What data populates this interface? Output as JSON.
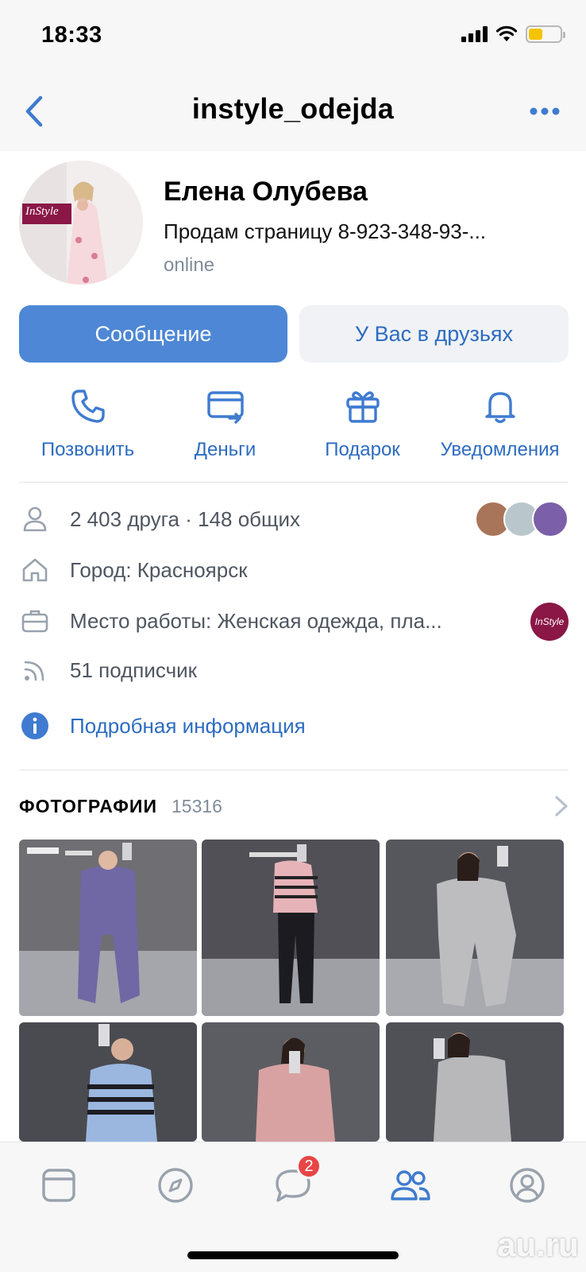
{
  "status_bar": {
    "time": "18:33"
  },
  "nav": {
    "title": "instyle_odejda"
  },
  "profile": {
    "name": "Елена Олубева",
    "status": "Продам страницу 8-923-348-93-...",
    "online": "online",
    "avatar_logo": "InStyle"
  },
  "buttons": {
    "message": "Сообщение",
    "friends": "У Вас в друзьях"
  },
  "actions": [
    {
      "label": "Позвонить",
      "icon": "phone-icon"
    },
    {
      "label": "Деньги",
      "icon": "money-card-icon"
    },
    {
      "label": "Подарок",
      "icon": "gift-icon"
    },
    {
      "label": "Уведомления",
      "icon": "bell-icon"
    }
  ],
  "info": {
    "friends": "2 403 друга · 148 общих",
    "city": "Город: Красноярск",
    "work": "Место работы: Женская одежда, пла...",
    "work_logo": "InStyle",
    "followers": "51 подписчик",
    "more": "Подробная информация"
  },
  "photos": {
    "title": "ФОТОГРАФИИ",
    "count": "15316"
  },
  "tab_bar": {
    "messages_badge": "2"
  },
  "watermark": "au.ru",
  "colors": {
    "accent": "#4d87d5",
    "link": "#2d6cc0",
    "secondary_text": "#818c99",
    "badge": "#e64646"
  }
}
